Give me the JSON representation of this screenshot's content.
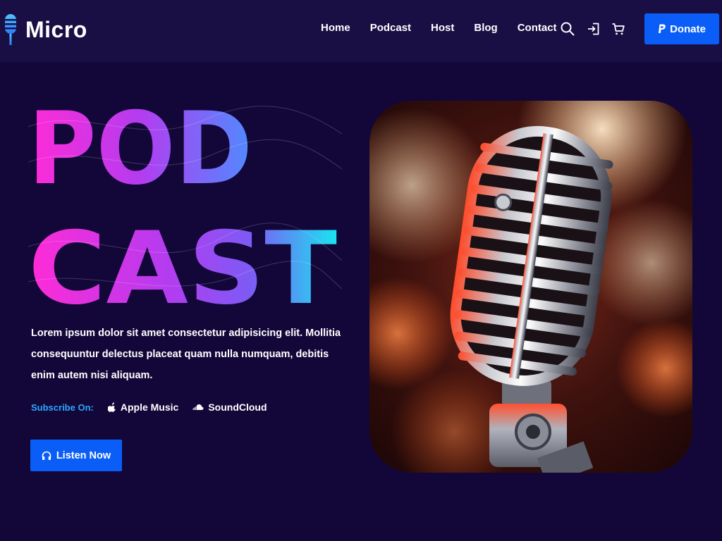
{
  "brand": {
    "name": "Micro"
  },
  "nav": {
    "items": [
      "Home",
      "Podcast",
      "Host",
      "Blog",
      "Contact"
    ]
  },
  "header_icons": [
    "search-icon",
    "login-icon",
    "cart-icon"
  ],
  "donate": {
    "label": "Donate",
    "icon": "paypal-icon"
  },
  "hero": {
    "title_line1": "POD",
    "title_line2": "CAST",
    "description": "Lorem ipsum dolor sit amet consectetur adipisicing elit. Mollitia consequuntur delectus placeat quam nulla numquam, debitis enim autem nisi aliquam.",
    "subscribe_label": "Subscribe On:",
    "subscribe_links": [
      {
        "label": "Apple Music",
        "icon": "apple-icon"
      },
      {
        "label": "SoundCloud",
        "icon": "soundcloud-icon"
      }
    ],
    "cta_label": "Listen Now",
    "cta_icon": "headphones-icon",
    "image_subject": "vintage-microphone"
  },
  "colors": {
    "background": "#13073a",
    "header": "#1a0f45",
    "accent": "#0a5ef7",
    "subscribe": "#29a8ff",
    "gradient": [
      "#ff2bd6",
      "#a83bf0",
      "#19e5f0"
    ]
  }
}
